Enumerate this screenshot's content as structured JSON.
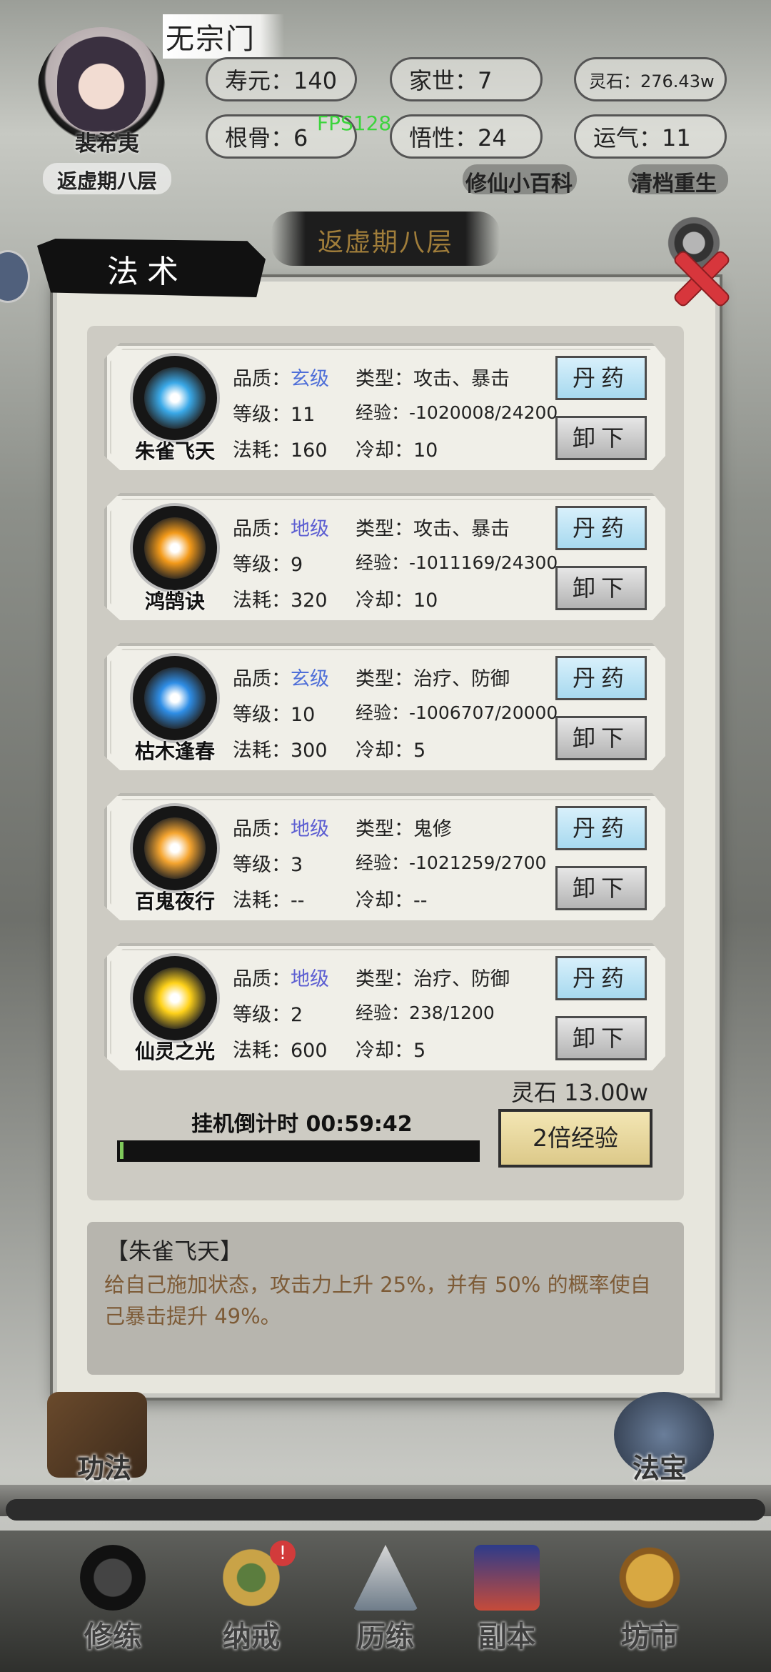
{
  "header": {
    "sect_name": "无宗门",
    "avatar_name": "裴希夷",
    "realm": "返虚期八层",
    "fps": "FPS128",
    "stats": {
      "lifespan": "寿元：140",
      "family": "家世：7",
      "spirit_stone": "灵石：276.43w",
      "root": "根骨：6",
      "insight": "悟性：24",
      "luck": "运气：11"
    },
    "encyclopedia_link": "修仙小百科",
    "reset_link": "清档重生",
    "realm_banner": "返虚期八层"
  },
  "dialog": {
    "title": "法术",
    "skills": [
      {
        "name": "朱雀飞天",
        "quality_label": "品质：",
        "quality": "玄级",
        "type": "类型：攻击、暴击",
        "level": "等级：11",
        "exp": "经验：-1020008/24200",
        "cost": "法耗：160",
        "cooldown": "冷却：10",
        "pill_btn": "丹药",
        "unequip_btn": "卸下",
        "icon_color": "#3aa9e8"
      },
      {
        "name": "鸿鹄诀",
        "quality_label": "品质：",
        "quality": "地级",
        "type": "类型：攻击、暴击",
        "level": "等级：9",
        "exp": "经验：-1011169/24300",
        "cost": "法耗：320",
        "cooldown": "冷却：10",
        "pill_btn": "丹药",
        "unequip_btn": "卸下",
        "icon_color": "#f39a1a"
      },
      {
        "name": "枯木逢春",
        "quality_label": "品质：",
        "quality": "玄级",
        "type": "类型：治疗、防御",
        "level": "等级：10",
        "exp": "经验：-1006707/20000",
        "cost": "法耗：300",
        "cooldown": "冷却：5",
        "pill_btn": "丹药",
        "unequip_btn": "卸下",
        "icon_color": "#2f8ee6"
      },
      {
        "name": "百鬼夜行",
        "quality_label": "品质：",
        "quality": "地级",
        "type": "类型：鬼修",
        "level": "等级：3",
        "exp": "经验：-1021259/2700",
        "cost": "法耗：--",
        "cooldown": "冷却：--",
        "pill_btn": "丹药",
        "unequip_btn": "卸下",
        "icon_color": "#f5a530"
      },
      {
        "name": "仙灵之光",
        "quality_label": "品质：",
        "quality": "地级",
        "type": "类型：治疗、防御",
        "level": "等级：2",
        "exp": "经验：238/1200",
        "cost": "法耗：600",
        "cooldown": "冷却：5",
        "pill_btn": "丹药",
        "unequip_btn": "卸下",
        "icon_color": "#ffd21a"
      }
    ],
    "spirit_stone_cost": "灵石 13.00w",
    "idle_countdown": "挂机倒计时 00:59:42",
    "idle_progress": 0.01,
    "double_exp_btn": "2倍经验",
    "description": {
      "title": "【朱雀飞天】",
      "text": "给自己施加状态，攻击力上升 25%，并有 50% 的概率使自己暴击提升 49%。"
    }
  },
  "side_buttons": {
    "left": "功法",
    "right": "法宝"
  },
  "nav": {
    "items": [
      "修练",
      "纳戒",
      "历练",
      "副本",
      "坊市"
    ],
    "ring_badge": "!"
  },
  "colors": {
    "quality_xuan": "#4f6fd8",
    "quality_di": "#5d5fd2",
    "fps": "#3cd43c",
    "close": "#d7363c"
  }
}
